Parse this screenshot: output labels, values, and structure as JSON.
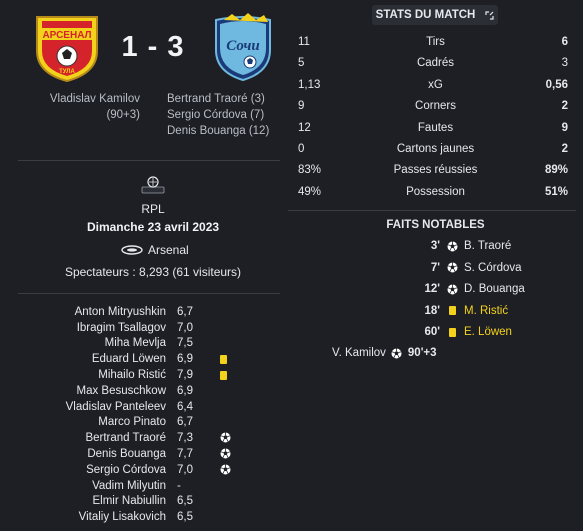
{
  "match": {
    "score": "1 - 3",
    "home_scorers": [
      "Vladislav Kamilov",
      "(90+3)"
    ],
    "away_scorers": [
      "Bertrand Traoré (3)",
      "Sergio Córdova (7)",
      "Denis Bouanga (12)"
    ],
    "league": "RPL",
    "date": "Dimanche 23 avril 2023",
    "venue": "Arsenal",
    "attendance": "Spectateurs : 8,293 (61 visiteurs)",
    "home_crest_text": "АРСЕНАЛ",
    "home_crest_sub": "ТУЛА",
    "away_crest_text": "Сочи"
  },
  "players": [
    {
      "name": "Anton Mitryushkin",
      "rating": "6,7",
      "event": ""
    },
    {
      "name": "Ibragim Tsallagov",
      "rating": "7,0",
      "event": ""
    },
    {
      "name": "Miha Mevlja",
      "rating": "7,5",
      "event": ""
    },
    {
      "name": "Eduard Löwen",
      "rating": "6,9",
      "event": "yellow"
    },
    {
      "name": "Mihailo Ristić",
      "rating": "7,9",
      "event": "yellow"
    },
    {
      "name": "Max Besuschkow",
      "rating": "6,9",
      "event": ""
    },
    {
      "name": "Vladislav Panteleev",
      "rating": "6,4",
      "event": ""
    },
    {
      "name": "Marco Pinato",
      "rating": "6,7",
      "event": ""
    },
    {
      "name": "Bertrand Traoré",
      "rating": "7,3",
      "event": "goal"
    },
    {
      "name": "Denis Bouanga",
      "rating": "7,7",
      "event": "goal"
    },
    {
      "name": "Sergio Córdova",
      "rating": "7,0",
      "event": "goal"
    },
    {
      "name": "Vadim Milyutin",
      "rating": "-",
      "event": ""
    },
    {
      "name": "Elmir Nabiullin",
      "rating": "6,5",
      "event": ""
    },
    {
      "name": "Vitaliy Lisakovich",
      "rating": "6,5",
      "event": ""
    }
  ],
  "stats": {
    "header": "STATS DU MATCH",
    "expand_icon": "expand-icon",
    "rows": [
      {
        "home": "11",
        "label": "Tirs",
        "away": "6",
        "home_bold": false,
        "away_bold": true
      },
      {
        "home": "5",
        "label": "Cadrés",
        "away": "3",
        "home_bold": false,
        "away_bold": false
      },
      {
        "home": "1,13",
        "label": "xG",
        "away": "0,56",
        "home_bold": false,
        "away_bold": true
      },
      {
        "home": "9",
        "label": "Corners",
        "away": "2",
        "home_bold": false,
        "away_bold": true
      },
      {
        "home": "12",
        "label": "Fautes",
        "away": "9",
        "home_bold": false,
        "away_bold": true
      },
      {
        "home": "0",
        "label": "Cartons jaunes",
        "away": "2",
        "home_bold": false,
        "away_bold": true
      },
      {
        "home": "83%",
        "label": "Passes réussies",
        "away": "89%",
        "home_bold": false,
        "away_bold": true
      },
      {
        "home": "49%",
        "label": "Possession",
        "away": "51%",
        "home_bold": false,
        "away_bold": true
      }
    ]
  },
  "notable": {
    "title": "FAITS NOTABLES",
    "away_events": [
      {
        "minute": "3'",
        "player": "B. Traoré",
        "type": "goal"
      },
      {
        "minute": "7'",
        "player": "S. Córdova",
        "type": "goal"
      },
      {
        "minute": "12'",
        "player": "D. Bouanga",
        "type": "goal"
      },
      {
        "minute": "18'",
        "player": "M. Ristić",
        "type": "yellow"
      },
      {
        "minute": "60'",
        "player": "E. Löwen",
        "type": "yellow"
      }
    ],
    "home_events": [
      {
        "minute": "90'+3",
        "player": "V. Kamilov",
        "type": "goal"
      }
    ]
  },
  "colors": {
    "background": "#1d1f24",
    "yellow_card": "#f3d21b",
    "home_primary": "#d4232b",
    "home_secondary": "#f3d21b",
    "away_primary": "#1a3a78",
    "away_secondary": "#6fb9e0"
  }
}
